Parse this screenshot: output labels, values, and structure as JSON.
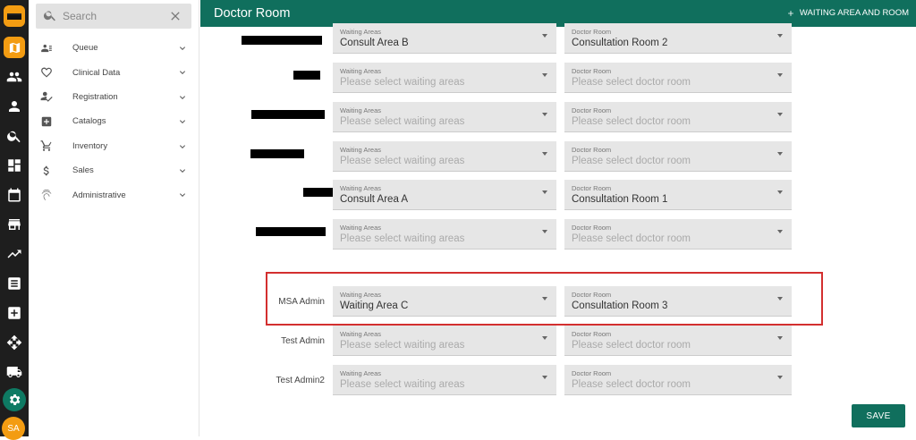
{
  "app": {
    "avatar_initials": "SA",
    "accent": "#106f5d",
    "brand": "#f39c12"
  },
  "rail": {
    "icons": [
      "logo",
      "map-icon",
      "people-icon",
      "person-icon",
      "search-icon",
      "dashboard-icon",
      "calendar-icon",
      "store-icon",
      "trending-icon",
      "document-icon",
      "medical-plus-icon",
      "arrows-move-icon",
      "truck-icon",
      "gear-icon"
    ]
  },
  "sidebar": {
    "search_placeholder": "Search",
    "items": [
      {
        "label": "Queue",
        "icon": "queue-icon"
      },
      {
        "label": "Clinical Data",
        "icon": "heart-icon"
      },
      {
        "label": "Registration",
        "icon": "register-icon"
      },
      {
        "label": "Catalogs",
        "icon": "plus-box-icon"
      },
      {
        "label": "Inventory",
        "icon": "cart-icon"
      },
      {
        "label": "Sales",
        "icon": "dollar-icon"
      },
      {
        "label": "Administrative",
        "icon": "fingerprint-icon"
      }
    ]
  },
  "header": {
    "title": "Doctor Room",
    "add_label": "WAITING AREA AND ROOM"
  },
  "form": {
    "waiting_label": "Waiting Areas",
    "room_label": "Doctor Room",
    "waiting_placeholder": "Please select waiting areas",
    "room_placeholder": "Please select doctor room",
    "rows": [
      {
        "user": "",
        "redacted": true,
        "waiting": "Consult Area B",
        "room": "Consultation Room 2"
      },
      {
        "user": "",
        "redacted": true,
        "waiting": "",
        "room": ""
      },
      {
        "user": "",
        "redacted": true,
        "waiting": "",
        "room": ""
      },
      {
        "user": "",
        "redacted": true,
        "waiting": "",
        "room": ""
      },
      {
        "user": "",
        "redacted": true,
        "waiting": "Consult Area A",
        "room": "Consultation Room 1"
      },
      {
        "user": "",
        "redacted": true,
        "waiting": "",
        "room": ""
      },
      {
        "user": "MSA Admin",
        "redacted": false,
        "waiting": "Waiting Area C",
        "room": "Consultation Room 3"
      },
      {
        "user": "Test Admin",
        "redacted": false,
        "waiting": "",
        "room": ""
      },
      {
        "user": "Test Admin2",
        "redacted": false,
        "waiting": "",
        "room": ""
      }
    ],
    "save_label": "SAVE"
  }
}
